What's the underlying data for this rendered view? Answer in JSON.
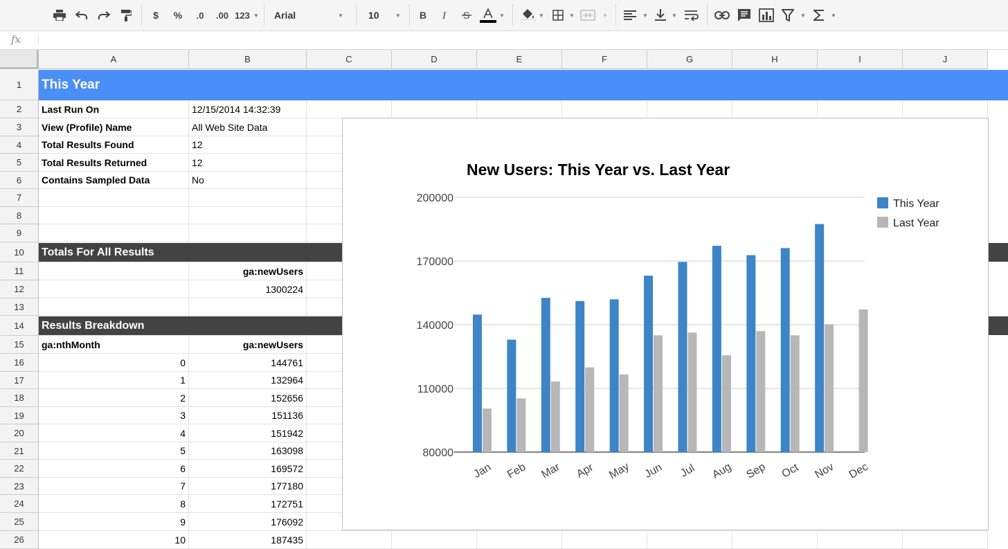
{
  "toolbar": {
    "font": "Arial",
    "font_size": "10",
    "currency": "$",
    "percent": "%",
    "dec_less": ".0",
    "dec_more": ".00",
    "more_formats": "123",
    "icons": [
      "print-icon",
      "undo-icon",
      "redo-icon",
      "paint-format-icon",
      "bold-icon",
      "italic-icon",
      "strikethrough-icon",
      "text-color-icon",
      "fill-color-icon",
      "borders-icon",
      "merge-icon",
      "align-icon",
      "valign-icon",
      "wrap-icon",
      "link-icon",
      "comment-icon",
      "chart-icon",
      "filter-icon",
      "functions-icon"
    ],
    "text_color": "#000000"
  },
  "formula_bar": {
    "fx": "fx",
    "value": ""
  },
  "columns": [
    "A",
    "B",
    "C",
    "D",
    "E",
    "F",
    "G",
    "H",
    "I",
    "J"
  ],
  "rows": [
    "1",
    "2",
    "3",
    "4",
    "5",
    "6",
    "7",
    "8",
    "9",
    "10",
    "11",
    "12",
    "13",
    "14",
    "15",
    "16",
    "17",
    "18",
    "19",
    "20",
    "21",
    "22",
    "23",
    "24",
    "25",
    "26"
  ],
  "sheet": {
    "title": "This Year",
    "meta": [
      {
        "label": "Last Run On",
        "value": "12/15/2014 14:32:39"
      },
      {
        "label": "View (Profile) Name",
        "value": "All Web Site Data"
      },
      {
        "label": "Total Results Found",
        "value": "12"
      },
      {
        "label": "Total Results Returned",
        "value": "12"
      },
      {
        "label": "Contains Sampled Data",
        "value": "No"
      }
    ],
    "totals_header": "Totals For All Results",
    "totals_col": "ga:newUsers",
    "totals_value": "1300224",
    "breakdown_header": "Results Breakdown",
    "breakdown_cols": [
      "ga:nthMonth",
      "ga:newUsers"
    ],
    "breakdown_rows": [
      [
        "0",
        "144761"
      ],
      [
        "1",
        "132964"
      ],
      [
        "2",
        "152656"
      ],
      [
        "3",
        "151136"
      ],
      [
        "4",
        "151942"
      ],
      [
        "5",
        "163098"
      ],
      [
        "6",
        "169572"
      ],
      [
        "7",
        "177180"
      ],
      [
        "8",
        "172751"
      ],
      [
        "9",
        "176092"
      ],
      [
        "10",
        "187435"
      ]
    ]
  },
  "colors": {
    "header_band": "#4a8ef7",
    "section_band": "#434343",
    "this_year": "#3d85c6",
    "last_year": "#b7b7b7"
  },
  "chart_data": {
    "type": "bar",
    "title": "New Users: This Year vs. Last Year",
    "xlabel": "",
    "ylabel": "",
    "categories": [
      "Jan",
      "Feb",
      "Mar",
      "Apr",
      "May",
      "Jun",
      "Jul",
      "Aug",
      "Sep",
      "Oct",
      "Nov",
      "Dec"
    ],
    "series": [
      {
        "name": "This Year",
        "color": "#3d85c6",
        "values": [
          144761,
          132964,
          152656,
          151136,
          151942,
          163098,
          169572,
          177180,
          172751,
          176092,
          187435,
          null
        ]
      },
      {
        "name": "Last Year",
        "color": "#b7b7b7",
        "values": [
          100500,
          105300,
          113300,
          119900,
          116600,
          135000,
          136300,
          125600,
          137000,
          135000,
          140200,
          147200
        ]
      }
    ],
    "ylim": [
      80000,
      200000
    ],
    "yticks": [
      "200000",
      "170000",
      "140000",
      "110000",
      "80000"
    ],
    "legend": "right",
    "grid": true
  }
}
